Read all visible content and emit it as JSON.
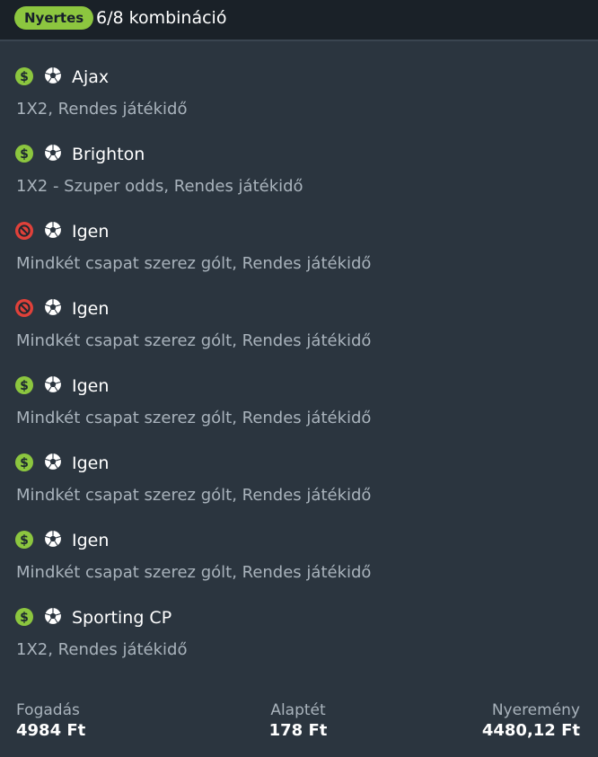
{
  "header": {
    "badge": "Nyertes",
    "title": "6/8 kombináció"
  },
  "colors": {
    "won": "#8cc63f",
    "lost": "#e0413a",
    "background": "#2b353f",
    "header_bg": "#1a2128",
    "secondary_text": "#a9b3bc"
  },
  "selections": [
    {
      "status": "won",
      "status_icon": "dollar-icon",
      "sport_icon": "soccer-ball-icon",
      "name": "Ajax",
      "desc": "1X2, Rendes játékidő"
    },
    {
      "status": "won",
      "status_icon": "dollar-icon",
      "sport_icon": "soccer-ball-icon",
      "name": "Brighton",
      "desc": "1X2 - Szuper odds, Rendes játékidő"
    },
    {
      "status": "lost",
      "status_icon": "prohibited-icon",
      "sport_icon": "soccer-ball-icon",
      "name": "Igen",
      "desc": "Mindkét csapat szerez gólt, Rendes játékidő"
    },
    {
      "status": "lost",
      "status_icon": "prohibited-icon",
      "sport_icon": "soccer-ball-icon",
      "name": "Igen",
      "desc": "Mindkét csapat szerez gólt, Rendes játékidő"
    },
    {
      "status": "won",
      "status_icon": "dollar-icon",
      "sport_icon": "soccer-ball-icon",
      "name": "Igen",
      "desc": "Mindkét csapat szerez gólt, Rendes játékidő"
    },
    {
      "status": "won",
      "status_icon": "dollar-icon",
      "sport_icon": "soccer-ball-icon",
      "name": "Igen",
      "desc": "Mindkét csapat szerez gólt, Rendes játékidő"
    },
    {
      "status": "won",
      "status_icon": "dollar-icon",
      "sport_icon": "soccer-ball-icon",
      "name": "Igen",
      "desc": "Mindkét csapat szerez gólt, Rendes játékidő"
    },
    {
      "status": "won",
      "status_icon": "dollar-icon",
      "sport_icon": "soccer-ball-icon",
      "name": "Sporting CP",
      "desc": "1X2, Rendes játékidő"
    }
  ],
  "footer": {
    "stake_label": "Fogadás",
    "stake_value": "4984 Ft",
    "base_label": "Alaptét",
    "base_value": "178 Ft",
    "winnings_label": "Nyeremény",
    "winnings_value": "4480,12 Ft"
  }
}
